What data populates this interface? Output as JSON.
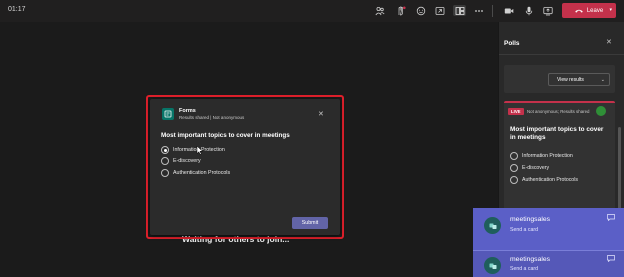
{
  "topbar": {
    "timer": "01:17",
    "icons": [
      "people-icon",
      "raise-hand-icon",
      "react-icon",
      "share-tray-icon",
      "apps-icon",
      "more-icon",
      "camera-icon",
      "mic-icon",
      "share-icon"
    ],
    "leave_label": "Leave"
  },
  "stage": {
    "waiting_text": "Waiting for others to join..."
  },
  "form_popup": {
    "app_name": "Forms",
    "subtitle": "Results shared | Not anonymous",
    "question": "Most important topics to cover in meetings",
    "options": [
      "Information Protection",
      "E-discovery",
      "Authentication Protocols"
    ],
    "selected_index": 0,
    "submit_label": "Submit"
  },
  "polls_panel": {
    "title": "Polls",
    "view_results_label": "View results",
    "live_card": {
      "badge": "LIVE",
      "meta": "Not anonymous; Results shared",
      "question": "Most important topics to cover in meetings",
      "options": [
        "Information Protection",
        "E-discovery",
        "Authentication Protocols"
      ]
    }
  },
  "notifications": [
    {
      "sender": "meetingsales",
      "message": "Send a card"
    },
    {
      "sender": "meetingsales",
      "message": "Send a card"
    }
  ],
  "colors": {
    "accent": "#6264a7",
    "leave": "#c4314b",
    "highlight_box": "#e0202b",
    "toast": "#5b5fc7",
    "forms_brand": "#077568"
  }
}
